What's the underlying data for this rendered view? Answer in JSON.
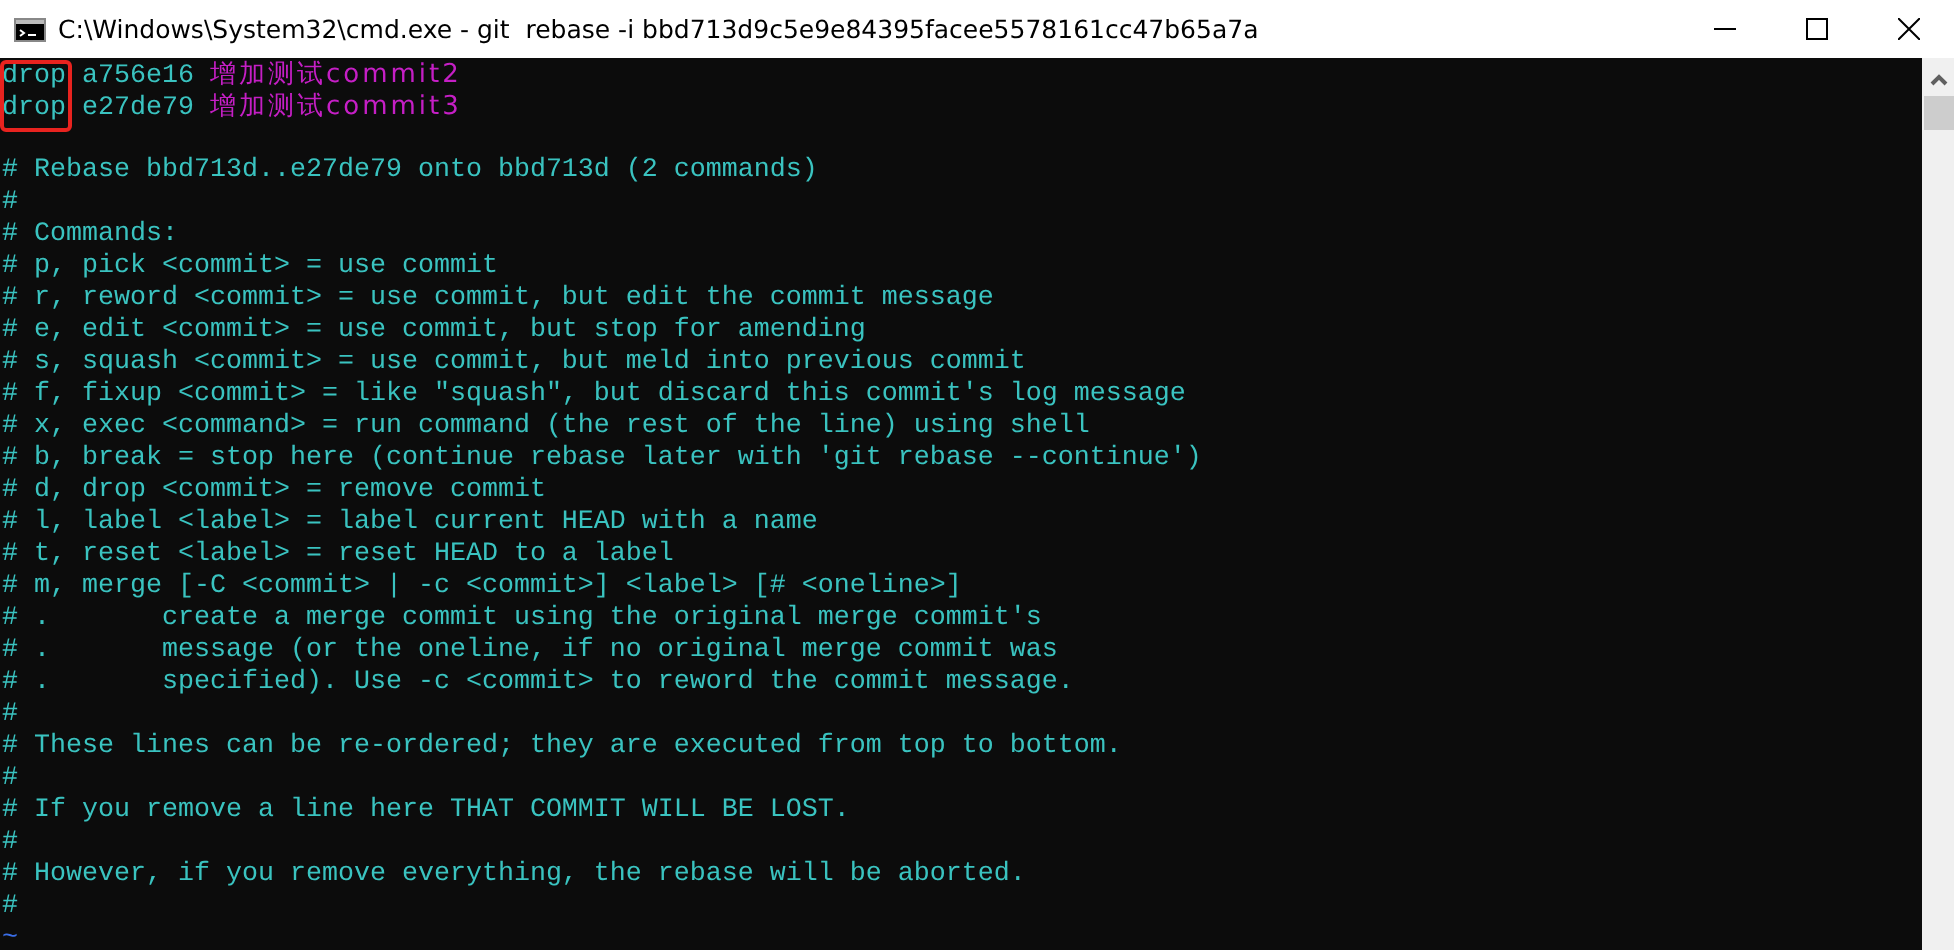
{
  "window": {
    "title": "C:\\Windows\\System32\\cmd.exe - git  rebase -i bbd713d9c5e9e84395facee5578161cc47b65a7a"
  },
  "command_highlight": true,
  "lines": [
    {
      "kind": "todo",
      "command": "drop",
      "hash": "a756e16",
      "subject": "增加测试commit2"
    },
    {
      "kind": "todo",
      "command": "drop",
      "hash": "e27de79",
      "subject": "增加测试commit3"
    },
    {
      "kind": "blank"
    },
    {
      "kind": "comment",
      "text": "# Rebase bbd713d..e27de79 onto bbd713d (2 commands)"
    },
    {
      "kind": "comment",
      "text": "#"
    },
    {
      "kind": "comment",
      "text": "# Commands:"
    },
    {
      "kind": "comment",
      "text": "# p, pick <commit> = use commit"
    },
    {
      "kind": "comment",
      "text": "# r, reword <commit> = use commit, but edit the commit message"
    },
    {
      "kind": "comment",
      "text": "# e, edit <commit> = use commit, but stop for amending"
    },
    {
      "kind": "comment",
      "text": "# s, squash <commit> = use commit, but meld into previous commit"
    },
    {
      "kind": "comment",
      "text": "# f, fixup <commit> = like \"squash\", but discard this commit's log message"
    },
    {
      "kind": "comment",
      "text": "# x, exec <command> = run command (the rest of the line) using shell"
    },
    {
      "kind": "comment",
      "text": "# b, break = stop here (continue rebase later with 'git rebase --continue')"
    },
    {
      "kind": "comment",
      "text": "# d, drop <commit> = remove commit"
    },
    {
      "kind": "comment",
      "text": "# l, label <label> = label current HEAD with a name"
    },
    {
      "kind": "comment",
      "text": "# t, reset <label> = reset HEAD to a label"
    },
    {
      "kind": "comment",
      "text": "# m, merge [-C <commit> | -c <commit>] <label> [# <oneline>]"
    },
    {
      "kind": "comment",
      "text": "# .       create a merge commit using the original merge commit's"
    },
    {
      "kind": "comment",
      "text": "# .       message (or the oneline, if no original merge commit was"
    },
    {
      "kind": "comment",
      "text": "# .       specified). Use -c <commit> to reword the commit message."
    },
    {
      "kind": "comment",
      "text": "#"
    },
    {
      "kind": "comment",
      "text": "# These lines can be re-ordered; they are executed from top to bottom."
    },
    {
      "kind": "comment",
      "text": "#"
    },
    {
      "kind": "comment",
      "text": "# If you remove a line here THAT COMMIT WILL BE LOST."
    },
    {
      "kind": "comment",
      "text": "#"
    },
    {
      "kind": "comment",
      "text": "# However, if you remove everything, the rebase will be aborted."
    },
    {
      "kind": "comment",
      "text": "#"
    },
    {
      "kind": "tilde",
      "text": "~"
    }
  ]
}
